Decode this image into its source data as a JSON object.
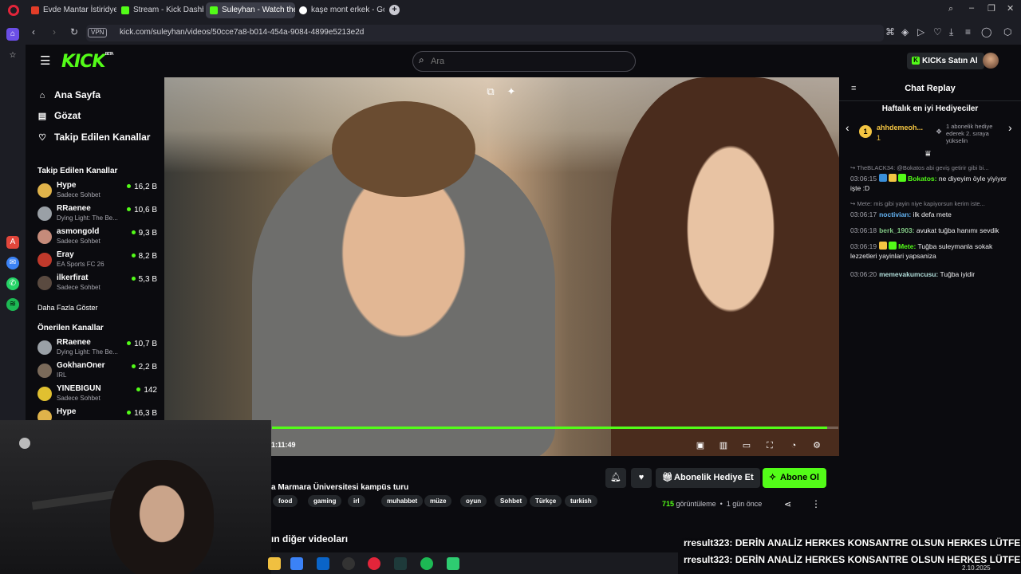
{
  "browser": {
    "tabs": [
      {
        "label": "Evde Mantar İstiridye Man",
        "color": "#e23d28"
      },
      {
        "label": "Stream - Kick Dashboard",
        "color": "#53fc18"
      },
      {
        "label": "Suleyhan - Watch the",
        "color": "#53fc18",
        "active": true
      },
      {
        "label": "kaşe mont erkek - Google",
        "color": "#ffffff"
      }
    ],
    "vpn": "VPN",
    "url": "kick.com/suleyhan/videos/50cce7a8-b014-454a-9084-4899e5213e2d",
    "icons": [
      "back-icon",
      "forward-icon",
      "reload-icon",
      "plus-icon",
      "search-icon",
      "minimize-icon",
      "maximize-icon",
      "close-icon"
    ]
  },
  "kick": {
    "logo": "KICK",
    "logo_beta": "BETA",
    "search_placeholder": "Ara",
    "kicks_button": "KICKs Satın Al",
    "accent": "#53fc18"
  },
  "sidebar": {
    "nav": [
      {
        "label": "Ana Sayfa",
        "icon": "⌂"
      },
      {
        "label": "Gözat",
        "icon": "▤"
      },
      {
        "label": "Takip Edilen Kanallar",
        "icon": "♡"
      }
    ],
    "followed_title": "Takip Edilen Kanallar",
    "followed": [
      {
        "name": "Hype",
        "sub": "Sadece Sohbet",
        "viewers": "16,2 B",
        "color": "#e0b34a"
      },
      {
        "name": "RRaenee",
        "sub": "Dying Light: The Be...",
        "viewers": "10,6 B",
        "color": "#9aa0a6"
      },
      {
        "name": "asmongold",
        "sub": "Sadece Sohbet",
        "viewers": "9,3 B",
        "color": "#c58b7a"
      },
      {
        "name": "Eray",
        "sub": "EA Sports FC 26",
        "viewers": "8,2 B",
        "color": "#c0392b"
      },
      {
        "name": "ilkerfirat",
        "sub": "Sadece Sohbet",
        "viewers": "5,3 B",
        "color": "#5a4a40"
      }
    ],
    "more_label": "Daha Fazla Göster",
    "suggested_title": "Önerilen Kanallar",
    "suggested": [
      {
        "name": "RRaenee",
        "sub": "Dying Light: The Be...",
        "viewers": "10,7 B",
        "color": "#9aa0a6"
      },
      {
        "name": "GokhanOner",
        "sub": "IRL",
        "viewers": "2,2 B",
        "color": "#7a6a5a"
      },
      {
        "name": "YINEBIGUN",
        "sub": "Sadece Sohbet",
        "viewers": "142",
        "color": "#e0c030"
      },
      {
        "name": "Hype",
        "sub": "",
        "viewers": "16,3 B",
        "color": "#e0b34a"
      }
    ]
  },
  "video": {
    "time": "1:11:49",
    "progress": 0.98,
    "title": "a Marmara Üniversitesi kampüs turu",
    "tags": [
      "food",
      "gaming",
      "irl",
      "muhabbet",
      "müze",
      "oyun",
      "Sohbet",
      "Türkçe",
      "turkish"
    ],
    "gift_button": "Abonelik Hediye Et",
    "subscribe_button": "Abone Ol",
    "views_count": "715",
    "views_label": "görüntüleme",
    "ago": "1 gün önce",
    "other_videos": "ın diğer videoları"
  },
  "chat": {
    "title": "Chat Replay",
    "gifters_title": "Haftalık en iyi Hediyeciler",
    "gifter_rank": "1",
    "gifter_name": "ahhdemeoh...",
    "gifter_count": "1",
    "gifter_note": "1 abonelik hediye ederek 2. sıraya yükselin",
    "messages": [
      {
        "reply": "TheBLACK34: @Bokatos abi geviş getirir gibi bi..."
      },
      {
        "time": "03:06:15",
        "user": "Bokatos:",
        "color": "#53fc18",
        "text": "ne diyeyim öyle yiyiyor işte :D",
        "badges": [
          "#3a8fd9",
          "#f4c542",
          "#53fc18"
        ]
      },
      {
        "reply": "Mete: mis gibi yayin niye kapiyorsun kerim iste..."
      },
      {
        "time": "03:06:17",
        "user": "noctivian:",
        "color": "#64b5f6",
        "text": "ilk defa mete"
      },
      {
        "time": "03:06:18",
        "user": "berk_1903:",
        "color": "#81c784",
        "text": "avukat tuğba hanımı sevdik"
      },
      {
        "time": "03:06:19",
        "user": "Mete:",
        "color": "#53fc18",
        "text": "Tuğba suleymanla sokak lezzetleri yayinlari yapsaniza",
        "badges": [
          "#f4c542",
          "#53fc18"
        ]
      },
      {
        "time": "03:06:20",
        "user": "memevakumcusu:",
        "color": "#b2dfdb",
        "text": "Tuğba iyidir"
      }
    ]
  },
  "overlay": {
    "lines": [
      {
        "user": "rresult323",
        "text": ": DERİN ANALİZ HERKES KONSANTRE OLSUN HERKES LÜTFEN"
      },
      {
        "user": "rresult323",
        "text": ": DERİN ANALİZ HERKES KONSANTRE OLSUN HERKES LÜTFEN"
      }
    ]
  },
  "taskbar": {
    "date": "2.10.2025"
  }
}
